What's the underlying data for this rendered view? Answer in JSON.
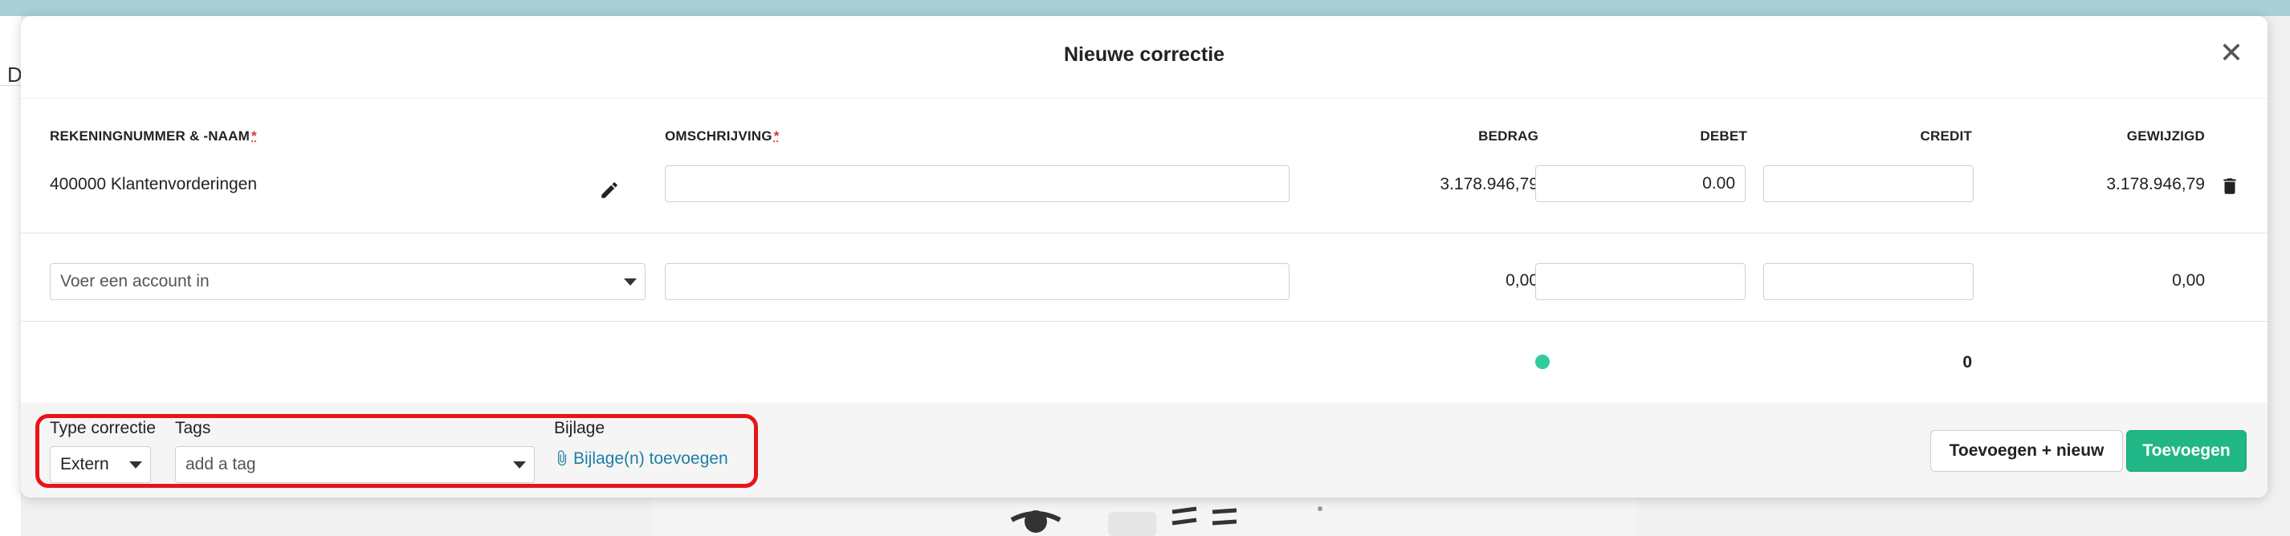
{
  "background": {
    "partial_text": "D",
    "banner_color": "#a9cfd6"
  },
  "modal": {
    "title": "Nieuwe correctie",
    "close_icon": "close-icon"
  },
  "columns": {
    "account": "REKENINGNUMMER & -NAAM",
    "description": "OMSCHRIJVING",
    "amount": "BEDRAG",
    "debit": "DEBET",
    "credit": "CREDIT",
    "changed": "GEWIJZIGD",
    "required_marker": "*"
  },
  "rows": [
    {
      "account": "400000 Klantenvorderingen",
      "description": "",
      "amount": "3.178.946,79",
      "debit": "0.00",
      "credit": "",
      "changed": "3.178.946,79",
      "icons": [
        "pencil-icon",
        "trash-icon"
      ]
    },
    {
      "account_placeholder": "Voer een account in",
      "description": "",
      "amount": "0,00",
      "debit": "",
      "credit": "",
      "changed": "0,00"
    }
  ],
  "totals": {
    "balance_status_color": "#2ecc9a",
    "credit_total": "0"
  },
  "footer": {
    "type_label": "Type correctie",
    "type_value": "Extern",
    "tags_label": "Tags",
    "tags_placeholder": "add a tag",
    "attachment_label": "Bijlage",
    "attachment_link": "Bijlage(n) toevoegen",
    "add_new_button": "Toevoegen + nieuw",
    "add_button": "Toevoegen",
    "primary_color": "#21b685",
    "highlight_color": "#e8141b"
  }
}
